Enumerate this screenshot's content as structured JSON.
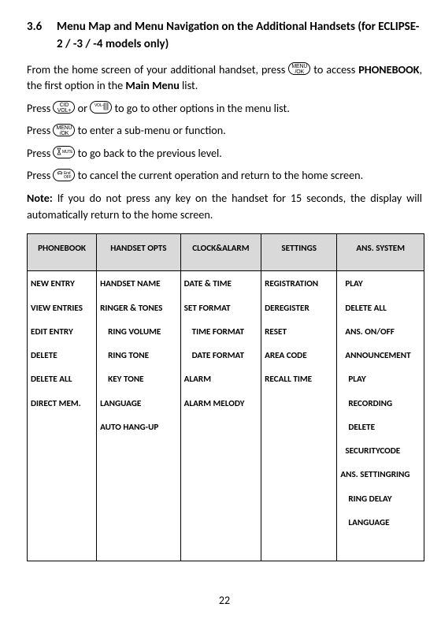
{
  "section": {
    "number": "3.6",
    "title": "Menu Map and Menu Navigation on the Additional Handsets (for ECLIPSE-2 / -3 / -4 models only)"
  },
  "paragraphs": {
    "p1a": "From the home screen of your additional handset, press ",
    "p1b": " to access ",
    "p1c": "PHONEBOOK",
    "p1d": ", the first option in the ",
    "p1e": "Main Menu",
    "p1f": " list.",
    "p2a": "Press ",
    "p2b": " or ",
    "p2c": " to go to other options in the menu list.",
    "p3a": "Press ",
    "p3b": " to enter a sub-menu or function.",
    "p4a": "Press ",
    "p4b": " to go back to the previous level.",
    "p5a": "Press ",
    "p5b": " to cancel the current operation and return to the home screen.",
    "noteLabel": "Note:",
    "noteBody": " If you do not press any key on the handset for 15 seconds, the display will automatically return to the home screen."
  },
  "keys": {
    "menu": "MENU\n/OK",
    "volup": "CID\nVOL+",
    "voldn": "VOL-",
    "mute": "MUTE",
    "end": "End\nOFF"
  },
  "table": {
    "headers": [
      "PHONEBOOK",
      "HANDSET OPTS",
      "CLOCK&ALARM",
      "SETTINGS",
      "ANS. SYSTEM"
    ],
    "cols": [
      [
        {
          "t": "NEW ENTRY"
        },
        {
          "t": "VIEW ENTRIES"
        },
        {
          "t": "EDIT ENTRY"
        },
        {
          "t": "DELETE"
        },
        {
          "t": "DELETE ALL"
        },
        {
          "t": "DIRECT MEM."
        }
      ],
      [
        {
          "t": "HANDSET NAME"
        },
        {
          "t": "RINGER & TONES"
        },
        {
          "t": "RING VOLUME",
          "indent": true
        },
        {
          "t": "RING TONE",
          "indent": true
        },
        {
          "t": "KEY TONE",
          "indent": true
        },
        {
          "t": "LANGUAGE"
        },
        {
          "t": "AUTO HANG-UP"
        }
      ],
      [
        {
          "t": "DATE & TIME"
        },
        {
          "t": "SET FORMAT"
        },
        {
          "t": "TIME FORMAT",
          "indent": true
        },
        {
          "t": "DATE FORMAT",
          "indent": true
        },
        {
          "t": "ALARM"
        },
        {
          "t": "ALARM MELODY"
        }
      ],
      [
        {
          "t": "REGISTRATION"
        },
        {
          "t": "DEREGISTER"
        },
        {
          "t": "RESET"
        },
        {
          "t": "AREA CODE"
        },
        {
          "t": "RECALL TIME"
        }
      ],
      [
        {
          "t": "PLAY",
          "indent2": true
        },
        {
          "t": "DELETE ALL",
          "indent2": true
        },
        {
          "t": "ANS. ON/OFF",
          "indent2": true
        },
        {
          "t": "ANNOUNCEMENT",
          "indent2": true
        },
        {
          "t": "PLAY",
          "indent": true
        },
        {
          "t": "RECORDING",
          "indent": true
        },
        {
          "t": "DELETE",
          "indent": true
        },
        {
          "t": "SECURITYCODE",
          "indent2": true
        },
        {
          "t": "ANS. SETTINGRING"
        },
        {
          "t": "RING DELAY",
          "indent": true
        },
        {
          "t": "LANGUAGE",
          "indent": true
        }
      ]
    ]
  },
  "pageNumber": "22"
}
